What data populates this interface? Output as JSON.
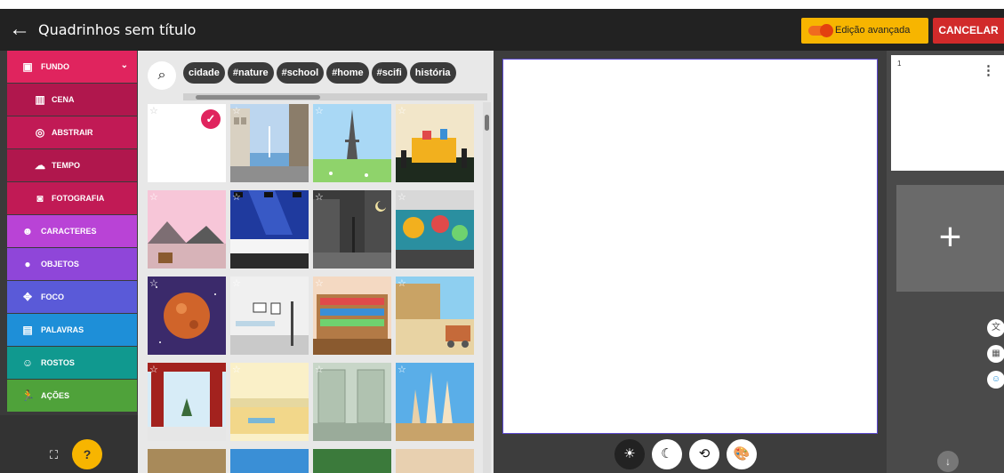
{
  "header": {
    "title": "Quadrinhos sem título",
    "advanced_label": "Edição avançada",
    "cancel_label": "CANCELAR"
  },
  "sidebar": {
    "items": [
      {
        "label": "FUNDO",
        "color": "#e0245e",
        "icon": "image-icon"
      },
      {
        "label": "CENA",
        "color": "#b0174d",
        "icon": "map-icon"
      },
      {
        "label": "ABSTRAIR",
        "color": "#c11a55",
        "icon": "spiral-icon"
      },
      {
        "label": "TEMPO",
        "color": "#b0174d",
        "icon": "cloud-rain-icon"
      },
      {
        "label": "FOTOGRAFIA",
        "color": "#c11a55",
        "icon": "camera-icon"
      },
      {
        "label": "CARACTERES",
        "color": "#b943d6",
        "icon": "face-icon"
      },
      {
        "label": "OBJETOS",
        "color": "#8f46d9",
        "icon": "object-icon"
      },
      {
        "label": "FOCO",
        "color": "#5a5ad8",
        "icon": "focus-icon"
      },
      {
        "label": "PALAVRAS",
        "color": "#1e8fd8",
        "icon": "speech-icon"
      },
      {
        "label": "ROSTOS",
        "color": "#10998f",
        "icon": "smile-icon"
      },
      {
        "label": "AÇÕES",
        "color": "#4fa23a",
        "icon": "run-icon"
      }
    ],
    "help_label": "?"
  },
  "gallery": {
    "tags": [
      "cidade",
      "#nature",
      "#school",
      "#home",
      "#scifi",
      "história"
    ]
  },
  "tools": [
    {
      "name": "light-mode",
      "icon": "☀"
    },
    {
      "name": "dark-mode",
      "icon": "☾"
    },
    {
      "name": "history",
      "icon": "⟲"
    },
    {
      "name": "palette",
      "icon": "🎨"
    }
  ],
  "panels": {
    "number": "1",
    "add_label": "+"
  },
  "colors": {
    "accent": "#f7b500",
    "cancel": "#d12a2a",
    "canvas_border": "#5e4bd1"
  }
}
